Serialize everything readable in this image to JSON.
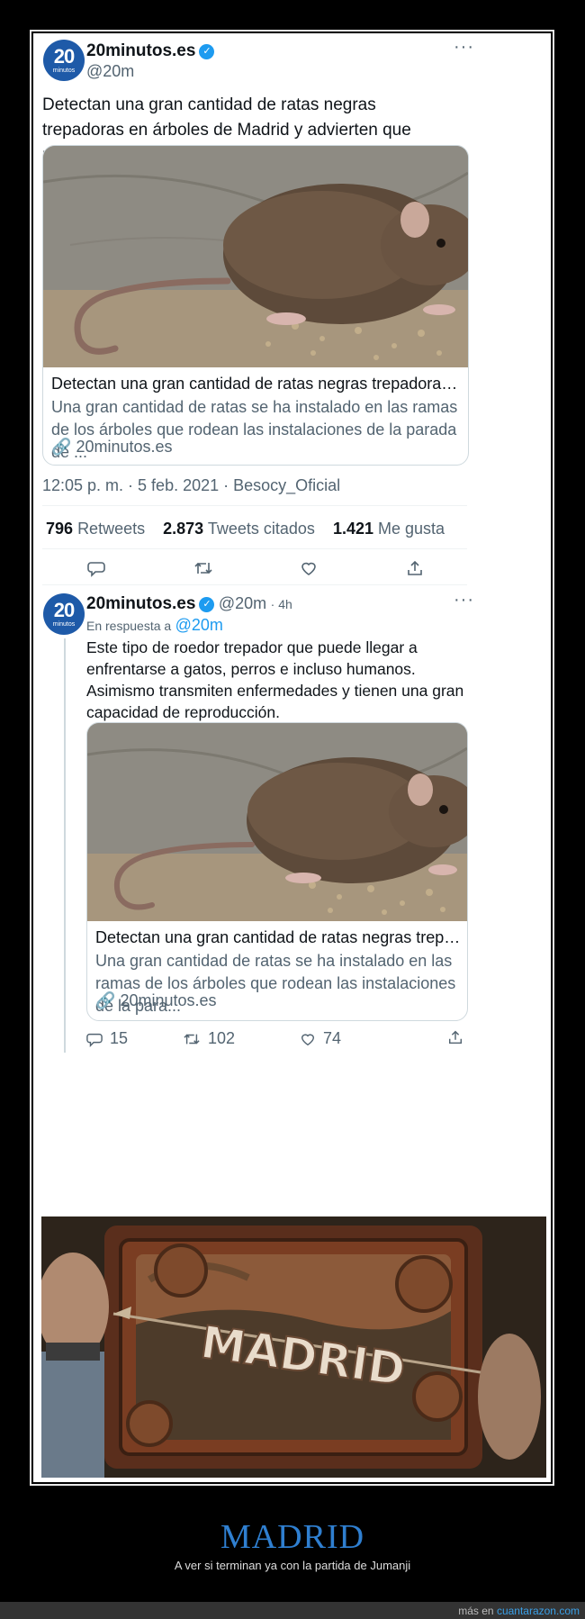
{
  "tweet": {
    "display_name": "20minutos.es",
    "handle": "@20m",
    "avatar_text": "20",
    "avatar_sub": "minutos",
    "text": "Detectan una gran cantidad de ratas negras trepadoras en árboles de Madrid y advierten que pueden atacar a humanos",
    "link_title": "Detectan una gran cantidad de ratas negras trepadoras en ár...",
    "link_desc": "Una gran cantidad de ratas se ha instalado en las ramas de los árboles que rodean las instalaciones de la parada de ...",
    "link_domain": "20minutos.es",
    "timestamp": "12:05 p. m. · 5 feb. 2021 · Besocy_Oficial",
    "retweets_count": "796",
    "retweets_label": "Retweets",
    "quotes_count": "2.873",
    "quotes_label": "Tweets citados",
    "likes_count": "1.421",
    "likes_label": "Me gusta"
  },
  "reply": {
    "display_name": "20minutos.es",
    "handle": "@20m",
    "time": "· 4h",
    "reply_prefix": "En respuesta a",
    "reply_to": "@20m",
    "text": "Este tipo de roedor trepador que puede llegar a enfrentarse a gatos, perros e incluso humanos. Asimismo transmiten enfermedades y tienen una gran capacidad de reproducción.",
    "link_title": "Detectan una gran cantidad de ratas negras trepadora...",
    "link_desc": "Una gran cantidad de ratas se ha instalado en las ramas de los árboles que rodean las instalaciones de la para...",
    "link_domain": "20minutos.es",
    "replies": "15",
    "retweets": "102",
    "likes": "74"
  },
  "meme_image": {
    "board_text": "MADRID"
  },
  "caption": {
    "title": "MADRID",
    "subtitle": "A ver si terminan ya con la partida de Jumanji"
  },
  "footer": {
    "prefix": "más en",
    "link": "cuantarazon.com"
  },
  "colors": {
    "verified": "#1d9bf0",
    "avatar": "#1e5aa8",
    "caption_title": "#2f7fd0"
  }
}
